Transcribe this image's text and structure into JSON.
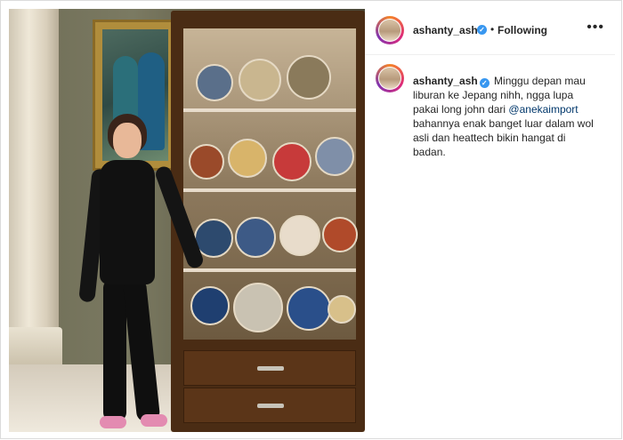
{
  "post": {
    "username": "ashanty_ash",
    "verified_mark": "✓",
    "separator": "•",
    "follow_status": "Following",
    "more_icon": "•••",
    "caption": {
      "part1": " Minggu depan mau liburan ke Jepang nihh, ngga lupa pakai long john dari ",
      "mention": "@anekaimport",
      "part2": " bahannya enak banget luar dalam wol asli dan heattech bikin hangat di badan."
    }
  },
  "colors": {
    "accent": "#3897f0",
    "mention": "#00376b"
  },
  "icons": [
    "verified-badge-icon",
    "more-options-icon"
  ]
}
